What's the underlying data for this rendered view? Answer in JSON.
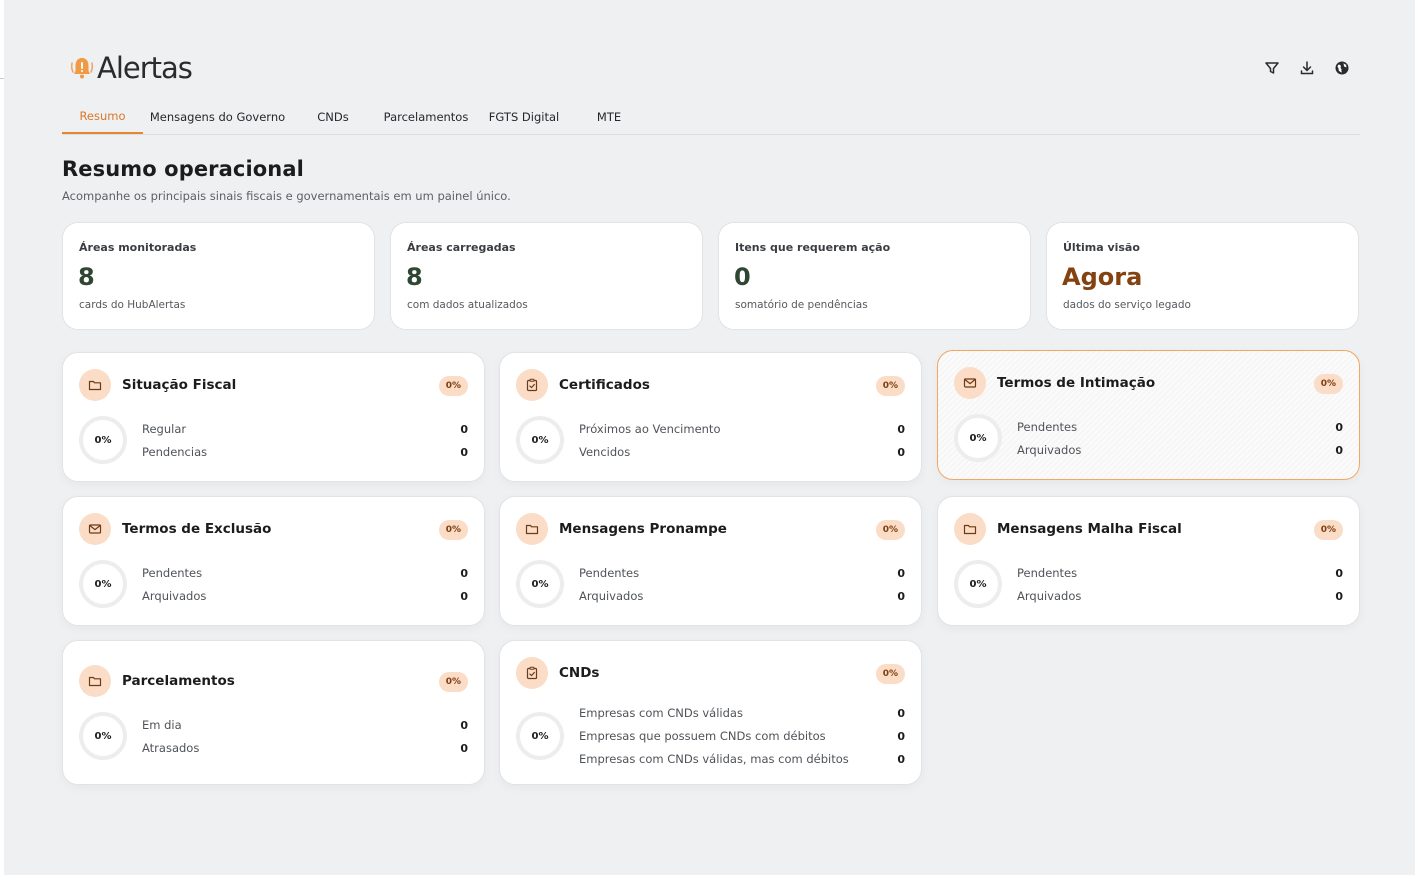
{
  "app": {
    "name": "Alertas",
    "brand_color": "#e8852f"
  },
  "header": {
    "actions": [
      {
        "name": "filter-icon",
        "label": ""
      },
      {
        "name": "download-icon",
        "label": ""
      },
      {
        "name": "globe-icon",
        "label": ""
      }
    ]
  },
  "tabs": [
    {
      "label": "Resumo",
      "active": true
    },
    {
      "label": "Mensagens do Governo",
      "active": false
    },
    {
      "label": "CNDs",
      "active": false
    },
    {
      "label": "Parcelamentos",
      "active": false
    },
    {
      "label": "FGTS Digital",
      "active": false
    },
    {
      "label": "MTE",
      "active": false
    }
  ],
  "page": {
    "title": "Resumo operacional",
    "subtitle": "Acompanhe os principais sinais fiscais e governamentais em um painel único."
  },
  "stats": [
    {
      "label": "Áreas monitoradas",
      "value": "8",
      "note": "cards do HubAlertas"
    },
    {
      "label": "Áreas carregadas",
      "value": "8",
      "note": "com dados atualizados"
    },
    {
      "label": "Itens que requerem ação",
      "value": "0",
      "note": "somatório de pendências"
    },
    {
      "label": "Última visão",
      "value": "Agora",
      "note": "dados do serviço legado"
    }
  ],
  "cards": [
    {
      "title": "Situação Fiscal",
      "icon": "folder-icon",
      "badge": "0%",
      "ring": "0%",
      "metrics": [
        {
          "label": "Regular",
          "value": "0"
        },
        {
          "label": "Pendencias",
          "value": "0"
        }
      ]
    },
    {
      "title": "Certificados",
      "icon": "clipboard-check-icon",
      "badge": "0%",
      "ring": "0%",
      "metrics": [
        {
          "label": "Próximos ao Vencimento",
          "value": "0"
        },
        {
          "label": "Vencidos",
          "value": "0"
        }
      ]
    },
    {
      "title": "Termos de Intimação",
      "icon": "mail-icon",
      "badge": "0%",
      "ring": "0%",
      "metrics": [
        {
          "label": "Pendentes",
          "value": "0"
        },
        {
          "label": "Arquivados",
          "value": "0"
        }
      ]
    },
    {
      "title": "Termos de Exclusão",
      "icon": "mail-icon",
      "badge": "0%",
      "ring": "0%",
      "metrics": [
        {
          "label": "Pendentes",
          "value": "0"
        },
        {
          "label": "Arquivados",
          "value": "0"
        }
      ]
    },
    {
      "title": "Mensagens Pronampe",
      "icon": "folder-icon",
      "badge": "0%",
      "ring": "0%",
      "metrics": [
        {
          "label": "Pendentes",
          "value": "0"
        },
        {
          "label": "Arquivados",
          "value": "0"
        }
      ]
    },
    {
      "title": "Mensagens Malha Fiscal",
      "icon": "folder-icon",
      "badge": "0%",
      "ring": "0%",
      "metrics": [
        {
          "label": "Pendentes",
          "value": "0"
        },
        {
          "label": "Arquivados",
          "value": "0"
        }
      ]
    },
    {
      "title": "Parcelamentos",
      "icon": "folder-icon",
      "badge": "0%",
      "ring": "0%",
      "metrics": [
        {
          "label": "Em dia",
          "value": "0"
        },
        {
          "label": "Atrasados",
          "value": "0"
        }
      ]
    },
    {
      "title": "CNDs",
      "icon": "clipboard-check-icon",
      "badge": "0%",
      "ring": "0%",
      "metrics": [
        {
          "label": "Empresas com CNDs válidas",
          "value": "0"
        },
        {
          "label": "Empresas que possuem CNDs com débitos",
          "value": "0"
        },
        {
          "label": "Empresas com CNDs válidas, mas com débitos",
          "value": "0"
        }
      ]
    }
  ]
}
